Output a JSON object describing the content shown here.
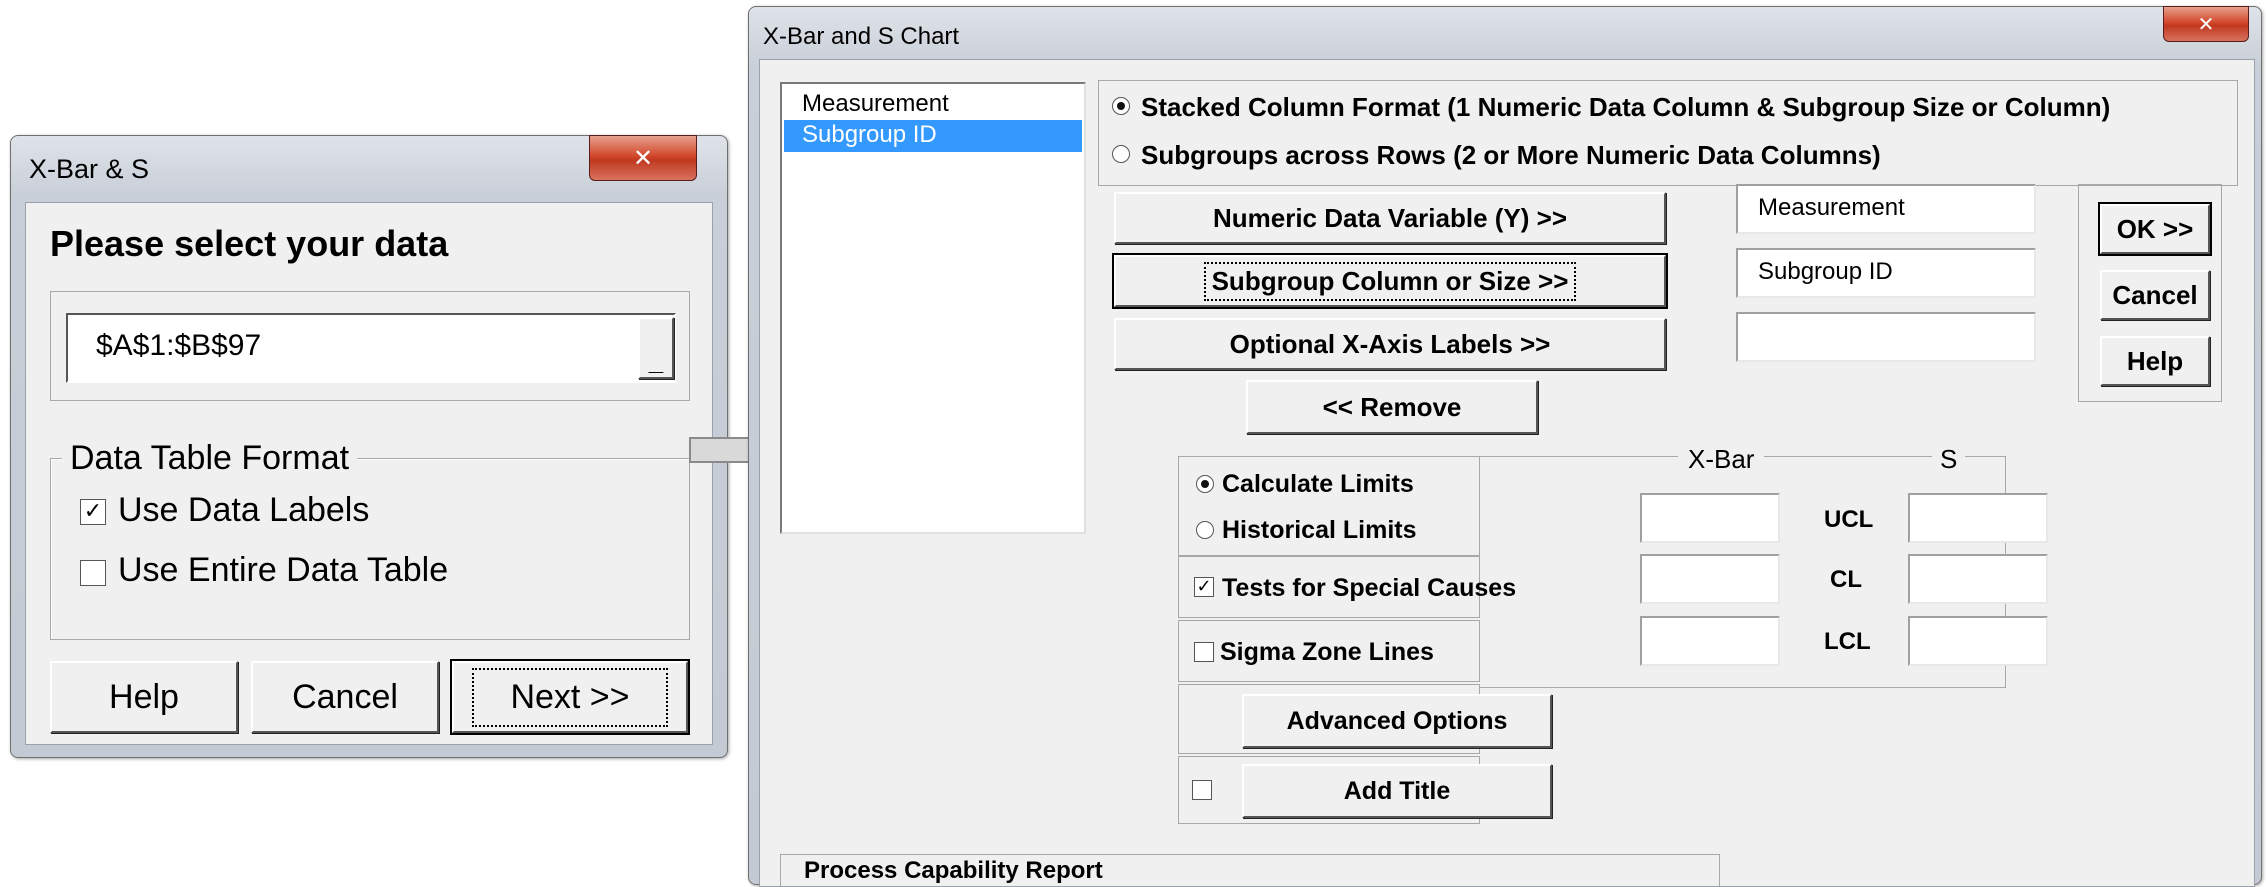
{
  "small_dialog": {
    "title": "X-Bar & S",
    "close_glyph": "✕",
    "prompt": "Please select your data",
    "range_value": "$A$1:$B$97",
    "range_button": "_",
    "group_label": "Data Table Format",
    "use_data_labels": {
      "label": "Use Data Labels",
      "checked": true
    },
    "use_entire_table": {
      "label": "Use Entire Data Table",
      "checked": false
    },
    "help_label": "Help",
    "cancel_label": "Cancel",
    "next_label": "Next >>"
  },
  "main_dialog": {
    "title": "X-Bar and S Chart",
    "close_glyph": "✕",
    "variables": [
      "Measurement",
      "Subgroup ID"
    ],
    "selected_variable_index": 1,
    "format_stacked": {
      "label": "Stacked Column Format (1 Numeric Data Column & Subgroup Size or Column)",
      "selected": true
    },
    "format_rows": {
      "label": "Subgroups across Rows (2 or More Numeric Data Columns)",
      "selected": false
    },
    "numeric_button": "Numeric Data Variable (Y) >>",
    "subgroup_button": "Subgroup Column or Size >>",
    "xaxis_button": "Optional X-Axis Labels >>",
    "numeric_value": "Measurement",
    "subgroup_value": "Subgroup ID",
    "xaxis_value": "",
    "remove_button": "<< Remove",
    "ok_button": "OK >>",
    "cancel_button": "Cancel",
    "help_button": "Help",
    "calc_limits": {
      "label": "Calculate Limits",
      "selected": true
    },
    "hist_limits": {
      "label": "Historical Limits",
      "selected": false
    },
    "tests_special": {
      "label": "Tests for Special Causes",
      "checked": true
    },
    "sigma_zone": {
      "label": "Sigma Zone Lines",
      "checked": false
    },
    "advanced_button": "Advanced Options",
    "add_title_button": "Add Title",
    "add_title_checked": false,
    "limits_header_xbar": "X-Bar",
    "limits_header_s": "S",
    "ucl_label": "UCL",
    "cl_label": "CL",
    "lcl_label": "LCL",
    "process_capability_label": "Process Capability Report"
  },
  "arrow_color": "#d9d9d9",
  "accent_selection": "#3399ff"
}
